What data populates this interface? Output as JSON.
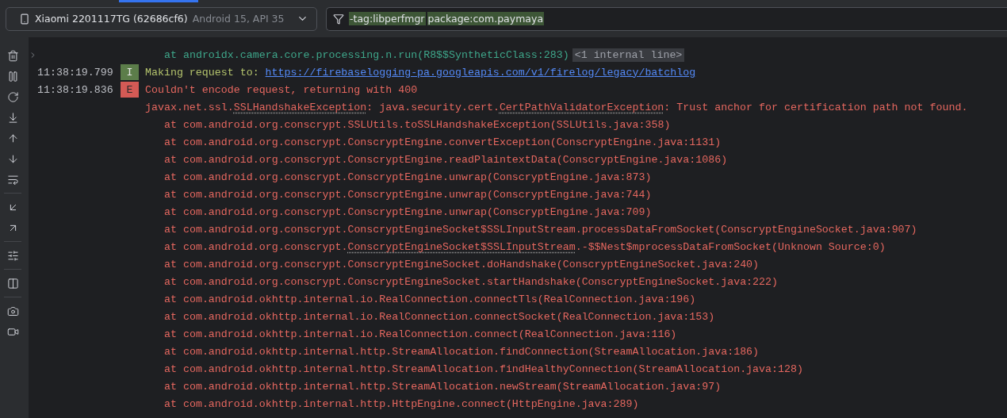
{
  "device_selector": {
    "name": "Xiaomi 2201117TG (62686cf6)",
    "detail": "Android 15, API 35"
  },
  "filter": {
    "tokens": [
      "-tag:libperfmgr",
      "package:com.paymaya"
    ]
  },
  "log_lines": [
    {
      "kind": "trace",
      "color": "#3ea68a",
      "fold": {
        "expanded": false
      },
      "parts": [
        {
          "kind": "plain",
          "text": "at androidx.camera.core.processing.n.run(R8$$SyntheticClass:283)"
        },
        {
          "kind": "folded",
          "text": "<1 internal line>"
        }
      ]
    },
    {
      "kind": "entry",
      "timestamp": "11:38:19.799",
      "level": "I",
      "parts": [
        {
          "kind": "plain",
          "text": "Making request to: "
        },
        {
          "kind": "link",
          "text": "https://firebaselogging-pa.googleapis.com/v1/firelog/legacy/batchlog"
        }
      ]
    },
    {
      "kind": "entry",
      "timestamp": "11:38:19.836",
      "level": "E",
      "parts": [
        {
          "kind": "plain",
          "text": "Couldn't encode request, returning with 400"
        }
      ]
    },
    {
      "kind": "continuation",
      "color": "#e5675f",
      "parts": [
        {
          "kind": "plain",
          "text": "javax.net.ssl."
        },
        {
          "kind": "dotted",
          "text": "SSLHandshakeException"
        },
        {
          "kind": "plain",
          "text": ": java.security.cert."
        },
        {
          "kind": "dotted",
          "text": "CertPathValidatorException"
        },
        {
          "kind": "plain",
          "text": ": Trust anchor for certification path not found."
        }
      ]
    },
    {
      "kind": "trace",
      "color": "#e5675f",
      "parts": [
        {
          "kind": "plain",
          "text": "at com.android.org.conscrypt.SSLUtils.toSSLHandshakeException(SSLUtils.java:358)"
        }
      ]
    },
    {
      "kind": "trace",
      "color": "#e5675f",
      "parts": [
        {
          "kind": "plain",
          "text": "at com.android.org.conscrypt.ConscryptEngine.convertException(ConscryptEngine.java:1131)"
        }
      ]
    },
    {
      "kind": "trace",
      "color": "#e5675f",
      "parts": [
        {
          "kind": "plain",
          "text": "at com.android.org.conscrypt.ConscryptEngine.readPlaintextData(ConscryptEngine.java:1086)"
        }
      ]
    },
    {
      "kind": "trace",
      "color": "#e5675f",
      "parts": [
        {
          "kind": "plain",
          "text": "at com.android.org.conscrypt.ConscryptEngine.unwrap(ConscryptEngine.java:873)"
        }
      ]
    },
    {
      "kind": "trace",
      "color": "#e5675f",
      "parts": [
        {
          "kind": "plain",
          "text": "at com.android.org.conscrypt.ConscryptEngine.unwrap(ConscryptEngine.java:744)"
        }
      ]
    },
    {
      "kind": "trace",
      "color": "#e5675f",
      "parts": [
        {
          "kind": "plain",
          "text": "at com.android.org.conscrypt.ConscryptEngine.unwrap(ConscryptEngine.java:709)"
        }
      ]
    },
    {
      "kind": "trace",
      "color": "#e5675f",
      "parts": [
        {
          "kind": "plain",
          "text": "at com.android.org.conscrypt.ConscryptEngineSocket$SSLInputStream.processDataFromSocket(ConscryptEngineSocket.java:907)"
        }
      ]
    },
    {
      "kind": "trace",
      "color": "#e5675f",
      "parts": [
        {
          "kind": "plain",
          "text": "at com.android.org.conscrypt."
        },
        {
          "kind": "dotted",
          "text": "ConscryptEngineSocket$SSLInputStream"
        },
        {
          "kind": "plain",
          "text": ".-$$Nest$mprocessDataFromSocket(Unknown Source:0)"
        }
      ]
    },
    {
      "kind": "trace",
      "color": "#e5675f",
      "parts": [
        {
          "kind": "plain",
          "text": "at com.android.org.conscrypt.ConscryptEngineSocket.doHandshake(ConscryptEngineSocket.java:240)"
        }
      ]
    },
    {
      "kind": "trace",
      "color": "#e5675f",
      "parts": [
        {
          "kind": "plain",
          "text": "at com.android.org.conscrypt.ConscryptEngineSocket.startHandshake(ConscryptEngineSocket.java:222)"
        }
      ]
    },
    {
      "kind": "trace",
      "color": "#e5675f",
      "parts": [
        {
          "kind": "plain",
          "text": "at com.android.okhttp.internal.io.RealConnection.connectTls(RealConnection.java:196)"
        }
      ]
    },
    {
      "kind": "trace",
      "color": "#e5675f",
      "parts": [
        {
          "kind": "plain",
          "text": "at com.android.okhttp.internal.io.RealConnection.connectSocket(RealConnection.java:153)"
        }
      ]
    },
    {
      "kind": "trace",
      "color": "#e5675f",
      "parts": [
        {
          "kind": "plain",
          "text": "at com.android.okhttp.internal.io.RealConnection.connect(RealConnection.java:116)"
        }
      ]
    },
    {
      "kind": "trace",
      "color": "#e5675f",
      "parts": [
        {
          "kind": "plain",
          "text": "at com.android.okhttp.internal.http.StreamAllocation.findConnection(StreamAllocation.java:186)"
        }
      ]
    },
    {
      "kind": "trace",
      "color": "#e5675f",
      "parts": [
        {
          "kind": "plain",
          "text": "at com.android.okhttp.internal.http.StreamAllocation.findHealthyConnection(StreamAllocation.java:128)"
        }
      ]
    },
    {
      "kind": "trace",
      "color": "#e5675f",
      "parts": [
        {
          "kind": "plain",
          "text": "at com.android.okhttp.internal.http.StreamAllocation.newStream(StreamAllocation.java:97)"
        }
      ]
    },
    {
      "kind": "trace",
      "color": "#e5675f",
      "parts": [
        {
          "kind": "plain",
          "text": "at com.android.okhttp.internal.http.HttpEngine.connect(HttpEngine.java:289)"
        }
      ]
    }
  ]
}
